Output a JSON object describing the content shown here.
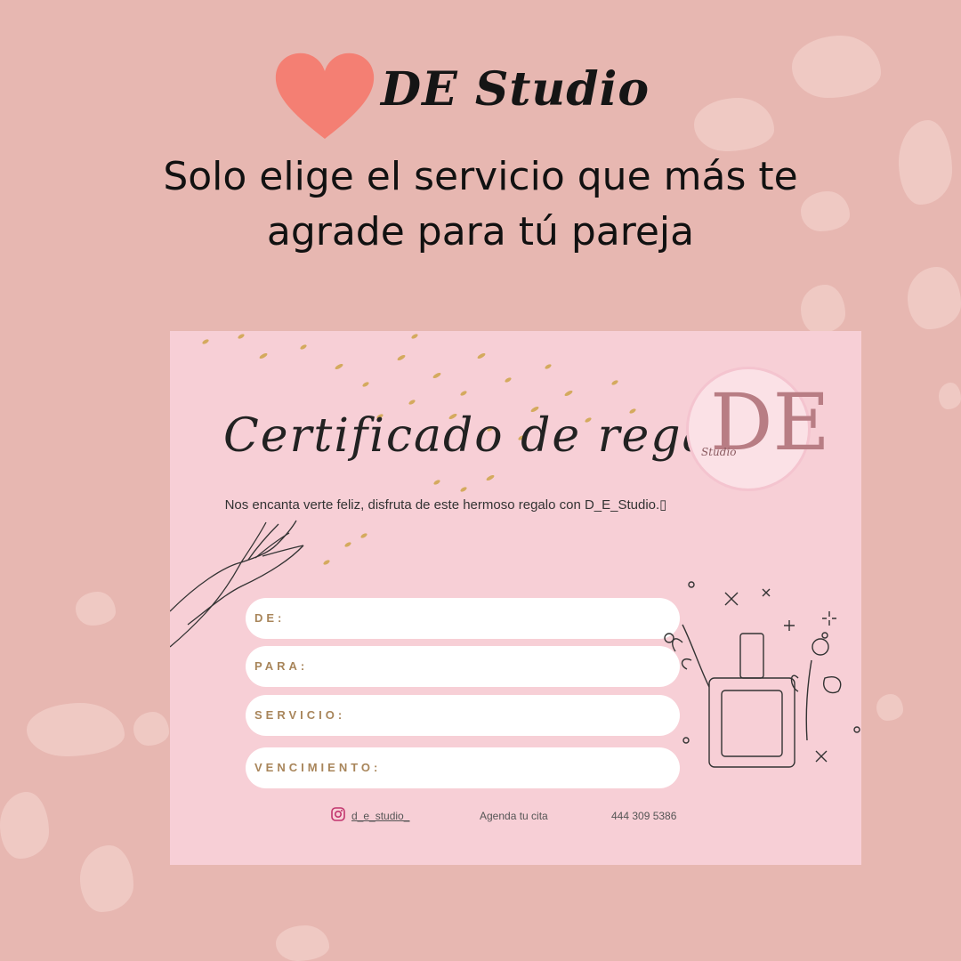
{
  "header": {
    "brand": "DE Studio",
    "tagline_line1": "Solo elige el servicio que más te",
    "tagline_line2": "agrade para tú pareja"
  },
  "certificate": {
    "title": "Certificado de regalo",
    "logo_letters": "DE",
    "logo_sub": "Studio",
    "message": "Nos encanta verte feliz, disfruta de este hermoso regalo con D_E_Studio.▯",
    "fields": [
      "DE:",
      "PARA:",
      "SERVICIO:",
      "VENCIMIENTO:"
    ],
    "instagram": "d_e_studio_",
    "cta": "Agenda tu cita",
    "phone": "444 309 5386"
  },
  "colors": {
    "background": "#e7b7b1",
    "card": "#f7cfd6",
    "heart": "#f47f73",
    "label": "#a8855a"
  }
}
